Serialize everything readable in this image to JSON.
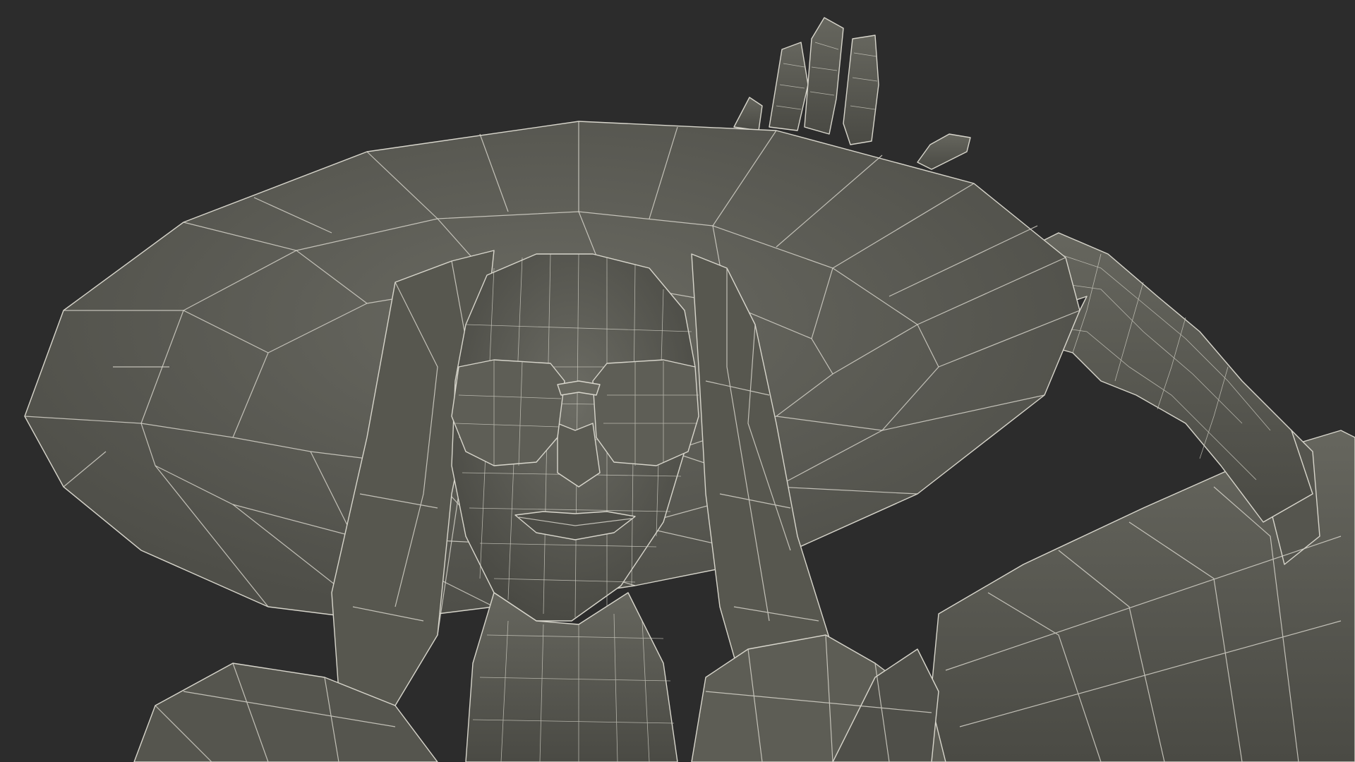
{
  "scene": {
    "subject": "wireframe-woman-sunhat-sunglasses",
    "background_color": "#2c2c2c",
    "surface_color": "#5c5c55",
    "wire_color": "#d8d6cc"
  },
  "icons": [
    "hat-icon",
    "sunglasses-icon",
    "hand-icon"
  ]
}
